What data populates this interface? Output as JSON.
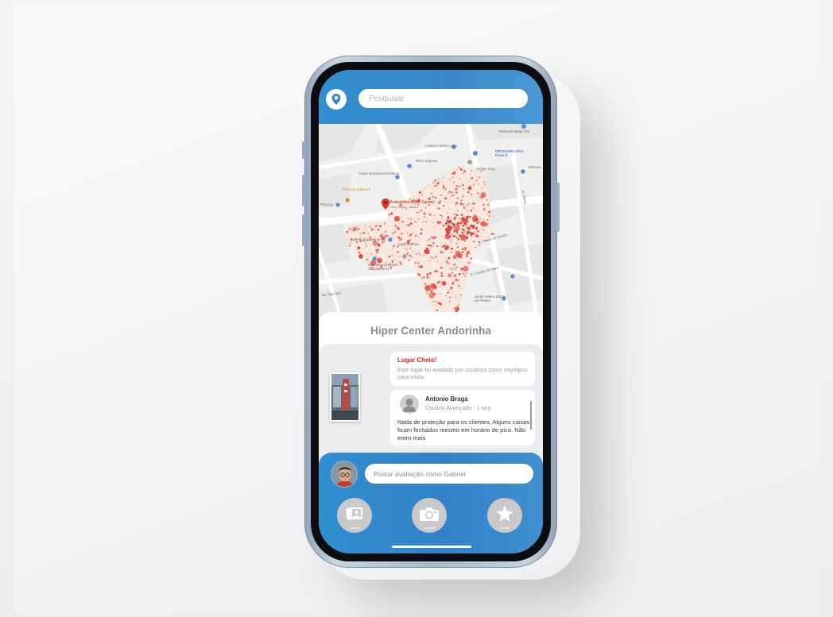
{
  "search": {
    "placeholder": "Pesquisar"
  },
  "map": {
    "labels": {
      "perfume": "Perfumes Beija Flor",
      "cantos": "Cantos Center Lider",
      "drogaria": "DROGARIA SÃO PAULO",
      "recoimporta": "Reco Importa",
      "burger": "Burger King",
      "caixa": "Caixa Econômica Federal",
      "telecom": "Telecom",
      "pizzaria": "Pizzaria Jallana II",
      "piazzag": "Piazzag",
      "hiper": "Andorinha Hiper Center",
      "hiper_sub": "Cash Center · Varejo",
      "galeria": "Galeria das Compras",
      "lojas": "Lojas Marisa",
      "beauty": "Mira Beauty Salon Cabeleireiros",
      "rua_paula": "R. Paula de Souza",
      "rua_cavalo": "R. Cavalo de Vara",
      "rua_paiva": "R. Paiva",
      "studio": "Studio Meira Studio de Pilates",
      "rua_sao": "Av. São Vito"
    }
  },
  "place": {
    "title": "Hiper Center Andorinha",
    "warning_title": "Lugar Cheio!",
    "warning_text": "Este lugar foi avaliado por usuários como impróprio para visita."
  },
  "review": {
    "author": "Antonio Braga",
    "role": "Usuário Avançado - 1 ano",
    "text": "Nada de proteção para os clientes. Alguns caixas ficam fechados mesmo em horário de pico. Não entro mais"
  },
  "compose": {
    "placeholder": "Postar avaliação como Gabriel"
  },
  "actions": [
    {
      "label": "Galeria",
      "icon": "gallery-icon"
    },
    {
      "label": "Câmera",
      "icon": "camera-icon"
    },
    {
      "label": "Avaliar",
      "icon": "star-icon"
    }
  ],
  "colors": {
    "accent_blue": "#3585cb",
    "warning_red": "#e0242a",
    "heat_red": "#e04a3c"
  }
}
